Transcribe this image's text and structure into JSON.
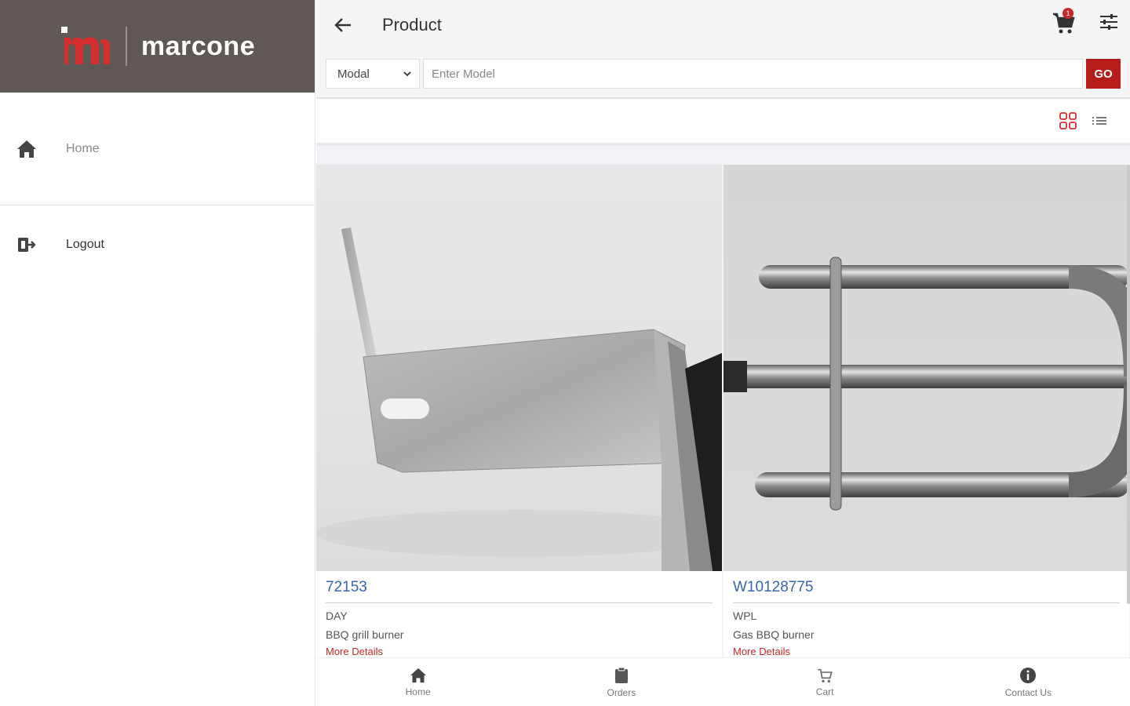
{
  "sidebar": {
    "brand_name": "marcone",
    "items": [
      {
        "label": "Home",
        "icon": "home-icon"
      },
      {
        "label": "Logout",
        "icon": "logout-icon"
      }
    ]
  },
  "header": {
    "title": "Product",
    "cart_badge": "1"
  },
  "search": {
    "select_value": "Modal",
    "placeholder": "Enter Model",
    "go_label": "GO"
  },
  "products": [
    {
      "part_number": "72153",
      "brand": "DAY",
      "description": "BBQ grill burner",
      "more": "More Details"
    },
    {
      "part_number": "W10128775",
      "brand": "WPL",
      "description": "Gas BBQ burner",
      "more": "More Details"
    }
  ],
  "tabs": [
    {
      "label": "Home",
      "icon": "home-icon"
    },
    {
      "label": "Orders",
      "icon": "clipboard-icon"
    },
    {
      "label": "Cart",
      "icon": "cart-icon"
    },
    {
      "label": "Contact Us",
      "icon": "info-icon"
    }
  ],
  "colors": {
    "brand_bar": "#5f5855",
    "accent": "#b71c1c",
    "link": "#3a66b0"
  }
}
